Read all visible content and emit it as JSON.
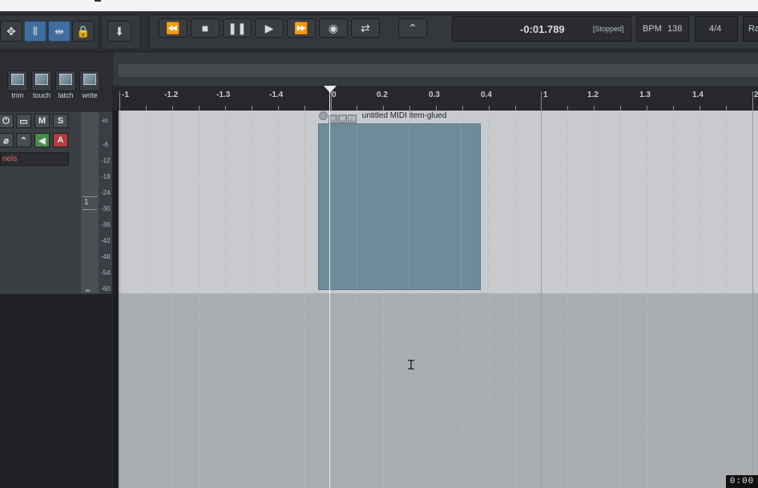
{
  "transport": {
    "time": "-0:01.789",
    "state": "[Stopped]",
    "bpm_label": "BPM",
    "bpm_value": "138",
    "time_signature": "4/4",
    "rate_label": "Ra"
  },
  "automation_modes": [
    "trim",
    "touch",
    "latch",
    "write"
  ],
  "track": {
    "mute_label": "M",
    "solo_label": "S",
    "automation_label": "A",
    "channels_label": "nels",
    "meter_label": "-in",
    "meter_scale": [
      "-6",
      "-12",
      "-18",
      "-24",
      "-30",
      "-36",
      "-42",
      "-48",
      "-54",
      "-60"
    ],
    "number": "1"
  },
  "ruler": {
    "labels": [
      "-1",
      "-1.2",
      "-1.3",
      "-1.4",
      "0",
      "0.2",
      "0.3",
      "0.4",
      "1",
      "1.2",
      "1.3",
      "1.4",
      "2"
    ]
  },
  "item": {
    "name": "untitled MIDI item-glued",
    "m_label": "M",
    "fx_label": "FX"
  },
  "clock": "0:00",
  "icons": {
    "rewind": "rewind-icon",
    "stop": "stop-icon",
    "pause": "pause-icon",
    "play": "play-icon",
    "forward": "fast-forward-icon",
    "record": "record-icon",
    "repeat": "repeat-icon",
    "envelope": "envelope-icon"
  }
}
